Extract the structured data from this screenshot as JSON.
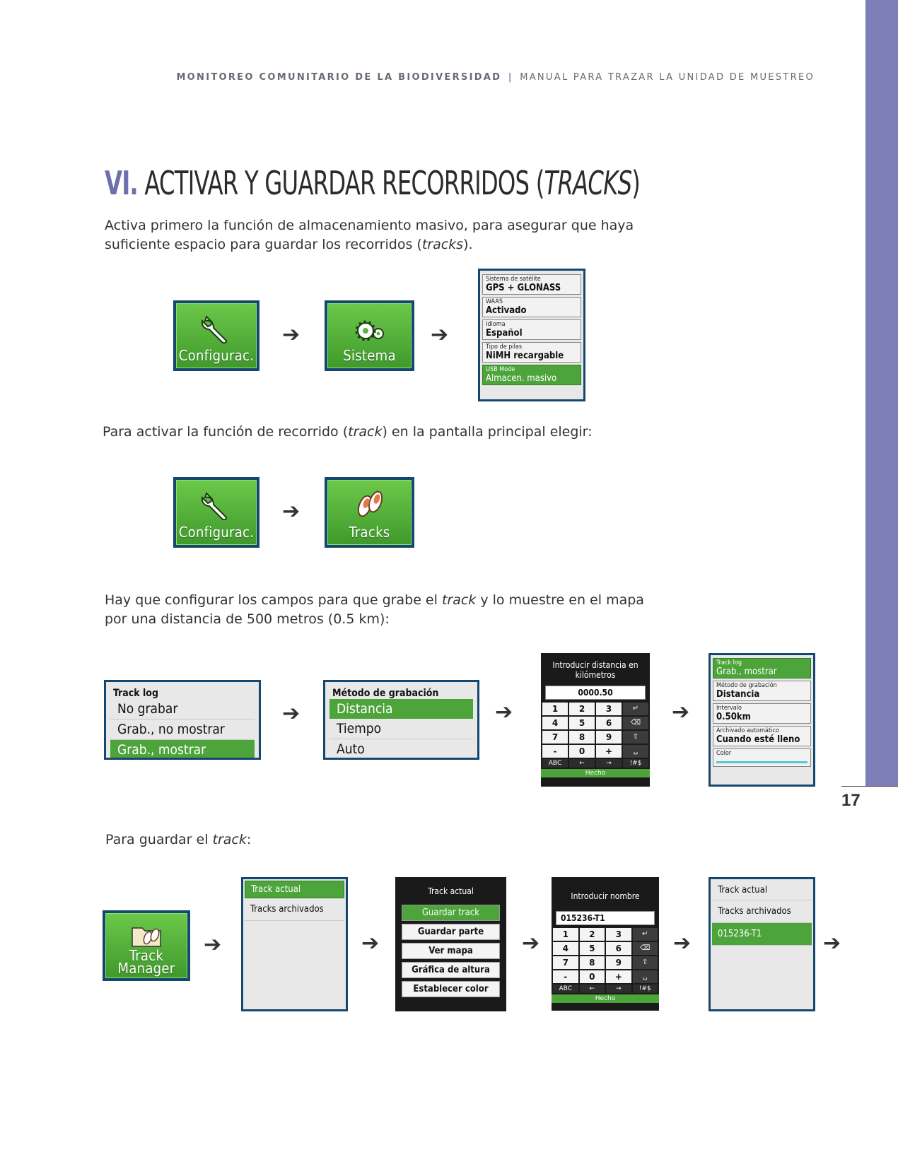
{
  "header": {
    "left": "MONITOREO COMUNITARIO DE LA BIODIVERSIDAD",
    "separator": "|",
    "right": "MANUAL PARA TRAZAR LA UNIDAD DE MUESTREO"
  },
  "title": {
    "number": "VI.",
    "text": "ACTIVAR Y GUARDAR RECORRIDOS (",
    "italic": "TRACKS",
    "close": ")"
  },
  "paragraphs": {
    "p1_a": "Activa primero la función de almacenamiento masivo, para asegurar que haya suficiente espacio para guardar los recorridos (",
    "p1_i": "tracks",
    "p1_b": ").",
    "p2_a": "Para activar la función de recorrido (",
    "p2_i": "track",
    "p2_b": ") en la pantalla principal elegir:",
    "p3_a": "Hay que configurar los campos para que grabe el ",
    "p3_i": "track",
    "p3_b": " y lo muestre en el mapa por una distancia de 500 metros (0.5 km):",
    "p4_a": "Para guardar el ",
    "p4_i": "track",
    "p4_b": ":"
  },
  "arrow": "➔",
  "tiles": {
    "config": "Configurac.",
    "sistema": "Sistema",
    "tracks": "Tracks",
    "track_manager_1": "Track",
    "track_manager_2": "Manager"
  },
  "system_screen": [
    {
      "label": "Sistema de satélite",
      "value": "GPS + GLONASS"
    },
    {
      "label": "WAAS",
      "value": "Activado"
    },
    {
      "label": "Idioma",
      "value": "Español"
    },
    {
      "label": "Tipo de pilas",
      "value": "NiMH recargable"
    },
    {
      "label": "USB Mode",
      "value": "Almacen. masivo"
    }
  ],
  "tracklog_screen": {
    "title": "Track log",
    "options": [
      "No grabar",
      "Grab., no mostrar",
      "Grab., mostrar"
    ]
  },
  "method_screen": {
    "title": "Método de grabación",
    "options": [
      "Distancia",
      "Tiempo",
      "Auto"
    ]
  },
  "distance_keypad": {
    "heading": "Introducir distancia en kilómetros",
    "entry": "0000.50",
    "keys": [
      "1",
      "2",
      "3",
      "↵",
      "4",
      "5",
      "6",
      "⌫",
      "7",
      "8",
      "9",
      "⇧",
      "-",
      "0",
      "+",
      "␣"
    ],
    "bottom": [
      "ABC",
      "←",
      "→",
      "!#$"
    ],
    "done": "Hecho"
  },
  "track_settings": [
    {
      "label": "Track log",
      "value": "Grab., mostrar"
    },
    {
      "label": "Método de grabación",
      "value": "Distancia"
    },
    {
      "label": "Intervalo",
      "value": "0.50km"
    },
    {
      "label": "Archivado automático",
      "value": "Cuando esté lleno"
    },
    {
      "label": "Color",
      "value": ""
    }
  ],
  "track_manager_screen": {
    "items": [
      "Track actual",
      "Tracks archivados"
    ]
  },
  "current_track_menu": {
    "title": "Track actual",
    "items": [
      "Guardar track",
      "Guardar parte",
      "Ver mapa",
      "Gráfica de altura",
      "Establecer color"
    ]
  },
  "name_keypad": {
    "heading": "Introducir nombre",
    "entry": "015236-T1",
    "keys": [
      "1",
      "2",
      "3",
      "↵",
      "4",
      "5",
      "6",
      "⌫",
      "7",
      "8",
      "9",
      "⇧",
      "-",
      "0",
      "+",
      "␣"
    ],
    "bottom": [
      "ABC",
      "←",
      "→",
      "!#$"
    ],
    "done": "Hecho"
  },
  "saved_screen": {
    "items": [
      "Track actual",
      "Tracks archivados",
      "015236-T1"
    ]
  },
  "page_number": "17",
  "colors": {
    "accent": "#7e7fb9",
    "green": "#4ca43a",
    "frame": "#154870"
  }
}
